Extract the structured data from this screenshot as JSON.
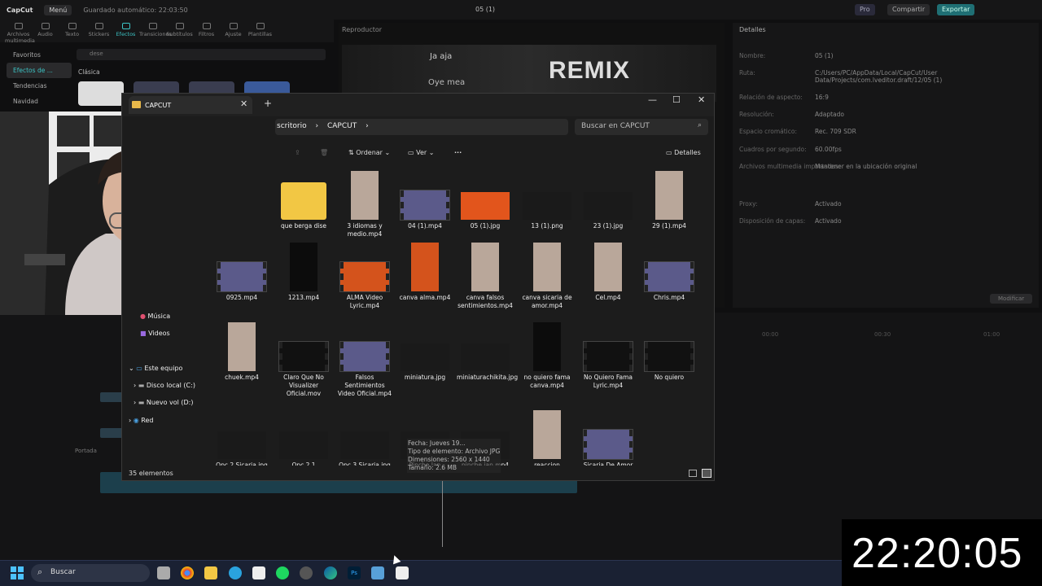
{
  "capcut": {
    "logo": "CapCut",
    "menu": "Menú",
    "saved": "Guardado automático: 22:03:50",
    "project": "05 (1)",
    "pro": "Pro",
    "share": "Compartir",
    "export": "Exportar",
    "tools": [
      "Archivos multimedia",
      "Audio",
      "Texto",
      "Stickers",
      "Efectos",
      "Transiciones",
      "Subtítulos",
      "Filtros",
      "Ajuste",
      "Plantillas"
    ],
    "active_tool": "Efectos",
    "side": [
      "Favoritos",
      "Efectos de ...",
      "Tendencias",
      "Navidad"
    ],
    "search": "dese",
    "clasica": "Clásica",
    "player_title": "Reproductor",
    "video_texts": {
      "remix": "REMIX",
      "jajaja": "Ja aja",
      "oyemea": "Oye mea"
    },
    "details_title": "Detalles",
    "details": [
      {
        "label": "Nombre:",
        "value": "05 (1)"
      },
      {
        "label": "Ruta:",
        "value": "C:/Users/PC/AppData/Local/CapCut/User Data/Projects/com.lveditor.draft/12/05 (1)"
      },
      {
        "label": "Relación de aspecto:",
        "value": "16:9"
      },
      {
        "label": "Resolución:",
        "value": "Adaptado"
      },
      {
        "label": "Espacio cromático:",
        "value": "Rec. 709 SDR"
      },
      {
        "label": "Cuadros por segundo:",
        "value": "60.00fps"
      },
      {
        "label": "Archivos multimedia importados:",
        "value": "Mantener en la ubicación original"
      },
      {
        "label": "Proxy:",
        "value": "Activado"
      },
      {
        "label": "Disposición de capas:",
        "value": "Activado"
      }
    ],
    "modify": "Modificar",
    "ruler": [
      "00:00",
      "00:30",
      "01:00"
    ],
    "portada": "Portada"
  },
  "explorer": {
    "tab_title": "CAPCUT",
    "breadcrumb": [
      "scritorio",
      "CAPCUT"
    ],
    "search_placeholder": "Buscar en CAPCUT",
    "sort": "Ordenar",
    "view": "Ver",
    "more": "···",
    "details": "Detalles",
    "nav": [
      "Música",
      "Videos",
      "Este equipo",
      "Disco local (C:)",
      "Nuevo vol (D:)",
      "Red"
    ],
    "status": "35 elementos",
    "tooltip": [
      "Fecha: Jueves 19...",
      "Tipo de elemento: Archivo JPG",
      "Dimensiones: 2560 x 1440",
      "Tamaño: 2.6 MB"
    ],
    "items": [
      {
        "name": "que berga dise",
        "kind": "folder"
      },
      {
        "name": "3 idiomas y medio.mp4",
        "kind": "portrait"
      },
      {
        "name": "04 (1).mp4",
        "kind": "film"
      },
      {
        "name": "05 (1).jpg",
        "kind": "orange"
      },
      {
        "name": "13 (1).png",
        "kind": "dark"
      },
      {
        "name": "23 (1).jpg",
        "kind": "dark"
      },
      {
        "name": "29 (1).mp4",
        "kind": "portrait"
      },
      {
        "name": "0925.mp4",
        "kind": "film"
      },
      {
        "name": "1213.mp4",
        "kind": "tall-dark"
      },
      {
        "name": "ALMA Video Lyric.mp4",
        "kind": "film-orange"
      },
      {
        "name": "canva alma.mp4",
        "kind": "tall-orange"
      },
      {
        "name": "canva falsos sentimientos.mp4",
        "kind": "portrait"
      },
      {
        "name": "canva sicaria de amor.mp4",
        "kind": "portrait"
      },
      {
        "name": "Cel.mp4",
        "kind": "portrait"
      },
      {
        "name": "Chris.mp4",
        "kind": "film"
      },
      {
        "name": "chuek.mp4",
        "kind": "portrait"
      },
      {
        "name": "Claro Que No Visualizer Oficial.mov",
        "kind": "film-dark"
      },
      {
        "name": "Falsos Sentimientos Video Oficial.mp4",
        "kind": "film"
      },
      {
        "name": "miniatura.jpg",
        "kind": "dark"
      },
      {
        "name": "miniaturachikita.jpg",
        "kind": "dark"
      },
      {
        "name": "no quiero fama canva.mp4",
        "kind": "tall-dark"
      },
      {
        "name": "No Quiero Fama Lyric.mp4",
        "kind": "film-dark"
      },
      {
        "name": "No quiero",
        "kind": "film-dark"
      },
      {
        "name": "Opc 2 Sicaria.jpg",
        "kind": "dark"
      },
      {
        "name": "Opc 2.1",
        "kind": "dark"
      },
      {
        "name": "Opc 3 Sicaria.jpg",
        "kind": "dark"
      },
      {
        "name": "Pinche Ian",
        "kind": "dark"
      },
      {
        "name": "pinche ian.mp4",
        "kind": "dark"
      },
      {
        "name": "reaccion",
        "kind": "portrait"
      },
      {
        "name": "Sicaria De Amor",
        "kind": "film"
      }
    ]
  },
  "taskbar": {
    "search": "Buscar"
  },
  "clock": "22:20:05"
}
